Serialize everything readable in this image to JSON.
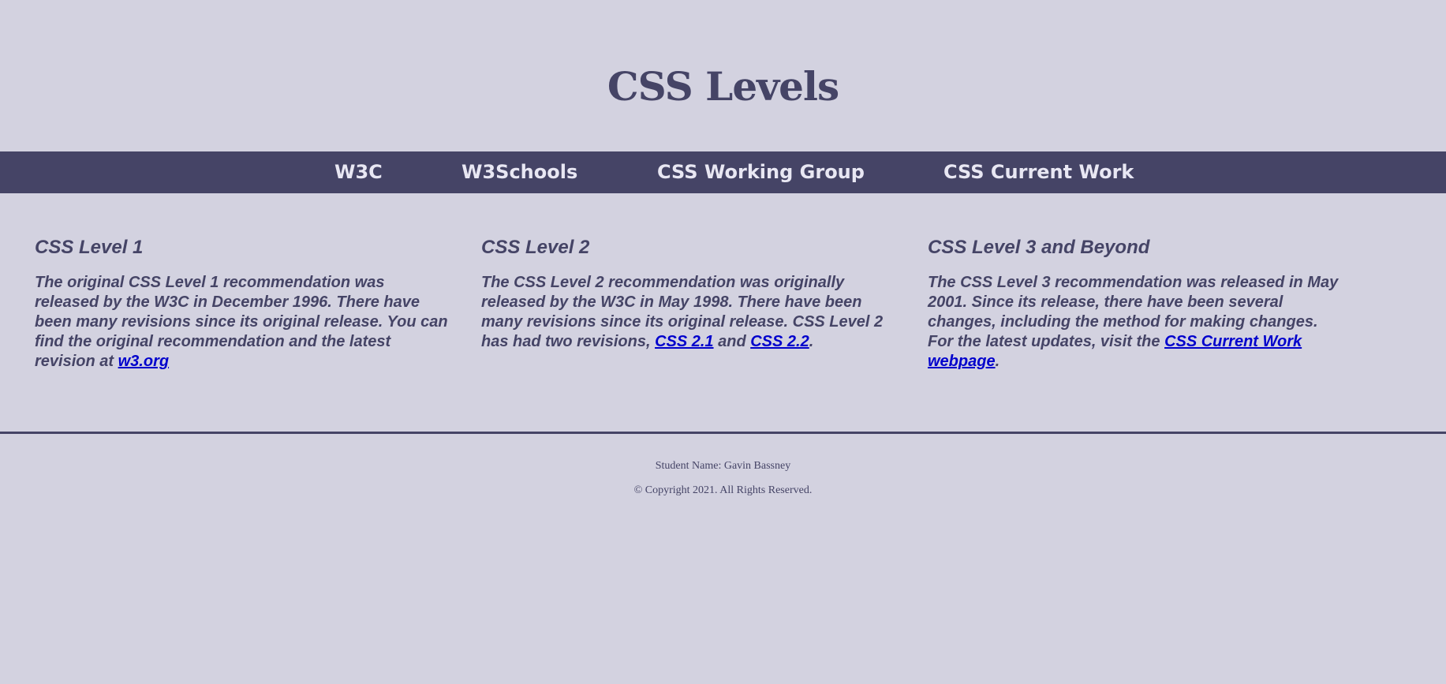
{
  "header": {
    "title": "CSS Levels"
  },
  "nav": {
    "items": [
      {
        "label": "W3C"
      },
      {
        "label": "W3Schools"
      },
      {
        "label": "CSS Working Group"
      },
      {
        "label": "CSS Current Work"
      }
    ]
  },
  "sections": [
    {
      "heading": "CSS Level 1",
      "text": "The original CSS Level 1 recommendation was released by the W3C in December 1996. There have been many revisions since its original release. You can find the original recommendation and the latest revision at ",
      "link": "w3.org"
    },
    {
      "heading": "CSS Level 2",
      "text_before": "The CSS Level 2 recommendation was originally released by the W3C in May 1998. There have been many revisions since its original release. CSS Level 2 has had two revisions, ",
      "link1": "CSS 2.1",
      "text_mid": " and ",
      "link2": "CSS 2.2",
      "text_after": "."
    },
    {
      "heading": "CSS Level 3 and Beyond",
      "text": "The CSS Level 3 recommendation was released in May 2001. Since its release, there have been several changes, including the method for making changes. For the latest updates, visit the ",
      "link": "CSS Current Work webpage",
      "text_after": "."
    }
  ],
  "footer": {
    "student": "Student Name: Gavin Bassney",
    "copyright": "© Copyright 2021. All Rights Reserved."
  },
  "colors": {
    "background": "#d3d2e0",
    "accent": "#454466",
    "nav_text": "#e8e7f3",
    "link": "#0000cc"
  }
}
